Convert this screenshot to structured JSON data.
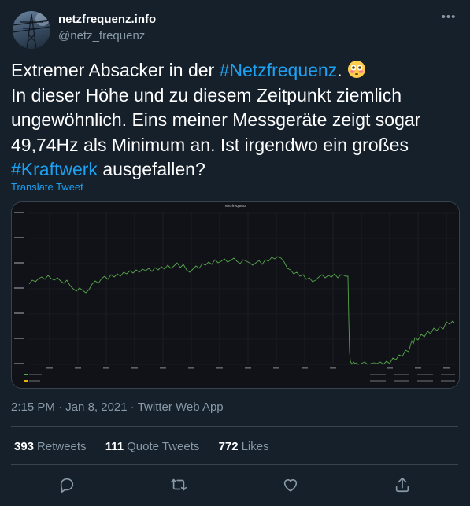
{
  "user": {
    "name": "netzfrequenz.info",
    "handle": "@netz_frequenz",
    "avatar_icon": "power-pylon-avatar"
  },
  "tweet": {
    "text_part1": "Extremer Absacker in der ",
    "hashtag1": "#Netzfrequenz",
    "text_part2": ".",
    "emoji": "flushed-face-emoji",
    "text_part3": "In dieser Höhe und zu diesem Zeitpunkt ziemlich ungewöhnlich. Eins meiner Messgeräte zeigt sogar 49,74Hz als Minimum an. Ist irgendwo ein großes ",
    "hashtag2": "#Kraftwerk",
    "text_part4": " ausgefallen?",
    "translate_label": "Translate Tweet"
  },
  "media": {
    "chart_title": "Netzfrequenz"
  },
  "meta": {
    "time": "2:15 PM",
    "date": "Jan 8, 2021",
    "sep": "·",
    "app": "Twitter Web App"
  },
  "stats": {
    "retweets_count": "393",
    "retweets_label": "Retweets",
    "quotes_count": "111",
    "quotes_label": "Quote Tweets",
    "likes_count": "772",
    "likes_label": "Likes"
  },
  "actions": [
    "reply-icon",
    "retweet-icon",
    "like-icon",
    "share-icon"
  ],
  "colors": {
    "background": "#15202b",
    "accent": "#1da1f2",
    "secondary_text": "#8899a6",
    "border": "#38444d",
    "chart_line": "#56a64b"
  }
}
